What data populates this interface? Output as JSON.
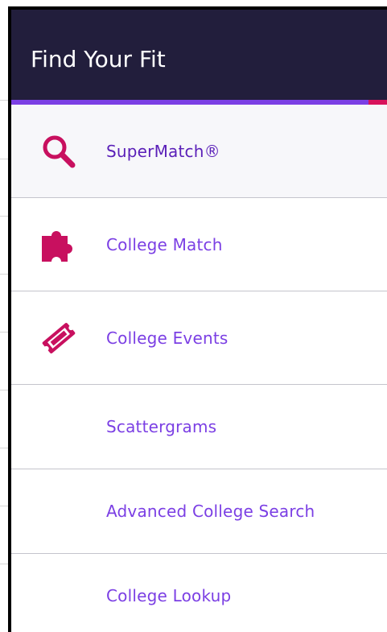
{
  "header": {
    "title": "Find Your Fit"
  },
  "colors": {
    "header_bg": "#221e3c",
    "accent_purple": "#7b3fe4",
    "accent_pink": "#d8125b",
    "icon_color": "#c8105f"
  },
  "menu": {
    "items": [
      {
        "label": "SuperMatch®",
        "icon": "search-icon",
        "active": true
      },
      {
        "label": "College Match",
        "icon": "puzzle-piece-icon"
      },
      {
        "label": "College Events",
        "icon": "ticket-icon"
      },
      {
        "label": "Scattergrams"
      },
      {
        "label": "Advanced College Search"
      },
      {
        "label": "College Lookup"
      }
    ]
  }
}
